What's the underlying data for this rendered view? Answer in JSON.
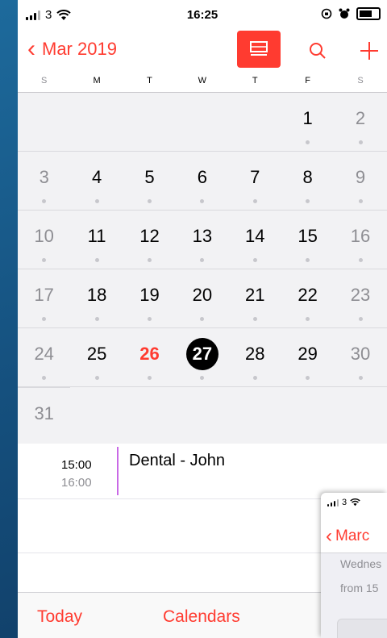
{
  "status": {
    "carrier": "3",
    "time": "16:25"
  },
  "nav": {
    "back_label": "Mar 2019"
  },
  "weekdays": [
    "S",
    "M",
    "T",
    "W",
    "T",
    "F",
    "S"
  ],
  "weeks": [
    [
      "",
      "",
      "",
      "",
      "",
      "1",
      "2"
    ],
    [
      "3",
      "4",
      "5",
      "6",
      "7",
      "8",
      "9"
    ],
    [
      "10",
      "11",
      "12",
      "13",
      "14",
      "15",
      "16"
    ],
    [
      "17",
      "18",
      "19",
      "20",
      "21",
      "22",
      "23"
    ],
    [
      "24",
      "25",
      "26",
      "27",
      "28",
      "29",
      "30"
    ],
    [
      "31"
    ]
  ],
  "today": "26",
  "selected": "27",
  "event": {
    "start": "15:00",
    "end": "16:00",
    "title": "Dental - John",
    "color": "#c969e6"
  },
  "tabbar": {
    "today": "Today",
    "calendars": "Calendars"
  },
  "overlay": {
    "carrier": "3",
    "back_label": "Marc",
    "line1": "Wednes",
    "line2": "from 15"
  },
  "colors": {
    "accent": "#ff3b30"
  }
}
